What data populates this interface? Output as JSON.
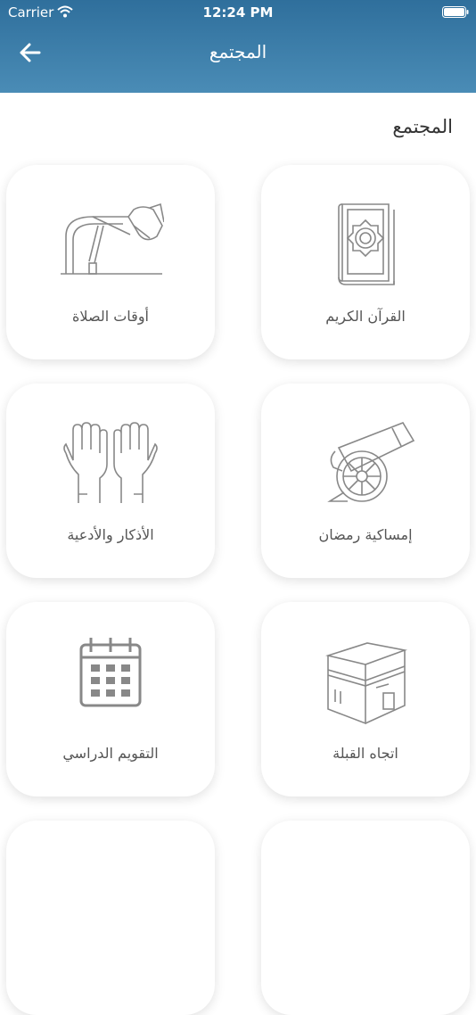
{
  "status_bar": {
    "carrier": "Carrier",
    "time": "12:24 PM"
  },
  "header": {
    "title": "المجتمع"
  },
  "section": {
    "title": "المجتمع"
  },
  "cards": [
    {
      "label": "القرآن الكريم",
      "icon": "quran-book-icon"
    },
    {
      "label": "أوقات الصلاة",
      "icon": "prayer-icon"
    },
    {
      "label": "إمساكية رمضان",
      "icon": "cannon-icon"
    },
    {
      "label": "الأذكار والأدعية",
      "icon": "dua-hands-icon"
    },
    {
      "label": "اتجاه القبلة",
      "icon": "kaaba-icon"
    },
    {
      "label": "التقويم الدراسي",
      "icon": "calendar-icon"
    }
  ]
}
